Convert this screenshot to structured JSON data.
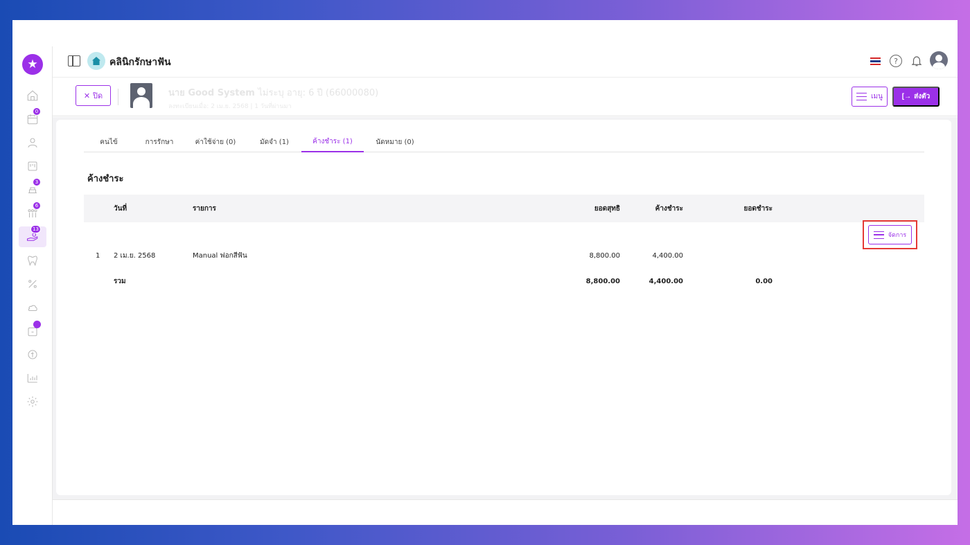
{
  "app": {
    "clinic_name": "คลินิกรักษาฟัน",
    "accent_color": "#9b30e8"
  },
  "sidebar": {
    "items": [
      {
        "icon": "home-icon",
        "badge": ""
      },
      {
        "icon": "calendar-icon",
        "badge": "0"
      },
      {
        "icon": "user-icon",
        "badge": ""
      },
      {
        "icon": "board-icon",
        "badge": ""
      },
      {
        "icon": "dental-chair-icon",
        "badge": "3"
      },
      {
        "icon": "queue-icon",
        "badge": "6"
      },
      {
        "icon": "payment-hand-icon",
        "badge": "13"
      },
      {
        "icon": "tooth-icon",
        "badge": ""
      },
      {
        "icon": "percent-icon",
        "badge": ""
      },
      {
        "icon": "cloud-icon",
        "badge": ""
      },
      {
        "icon": "calendar-dot-icon",
        "badge": ""
      },
      {
        "icon": "coin-icon",
        "badge": ""
      },
      {
        "icon": "chart-icon",
        "badge": ""
      },
      {
        "icon": "gear-icon",
        "badge": ""
      }
    ]
  },
  "header": {
    "close_label": "ปิด",
    "patient_name": "นาย Good System",
    "patient_name_sub": "ไม่ระบุ อายุ: 6 ปี (66000080)",
    "patient_meta": "ลงทะเบียนเมื่อ: 2 เม.ย. 2568 | 1 วันที่ผ่านมา",
    "menu_label": "เมนู",
    "send_label": "ส่งตัว"
  },
  "tabs": [
    {
      "label": "คนไข้",
      "active": false
    },
    {
      "label": "การรักษา",
      "active": false
    },
    {
      "label": "ค่าใช้จ่าย (0)",
      "active": false
    },
    {
      "label": "มัดจำ (1)",
      "active": false
    },
    {
      "label": "ค้างชำระ (1)",
      "active": true
    },
    {
      "label": "นัดหมาย (0)",
      "active": false
    }
  ],
  "section_title": "ค้างชำระ",
  "table": {
    "columns": {
      "date": "วันที่",
      "item": "รายการ",
      "net": "ยอดสุทธิ",
      "outstanding": "ค้างชำระ",
      "payment": "ยอดชำระ"
    },
    "rows": [
      {
        "no": "1",
        "date": "2 เม.ย. 2568",
        "item": "Manual ฟอกสีฟัน",
        "net": "8,800.00",
        "outstanding": "4,400.00",
        "payment": "",
        "action_label": "จัดการ"
      }
    ],
    "total": {
      "label": "รวม",
      "net": "8,800.00",
      "outstanding": "4,400.00",
      "payment": "0.00"
    }
  }
}
